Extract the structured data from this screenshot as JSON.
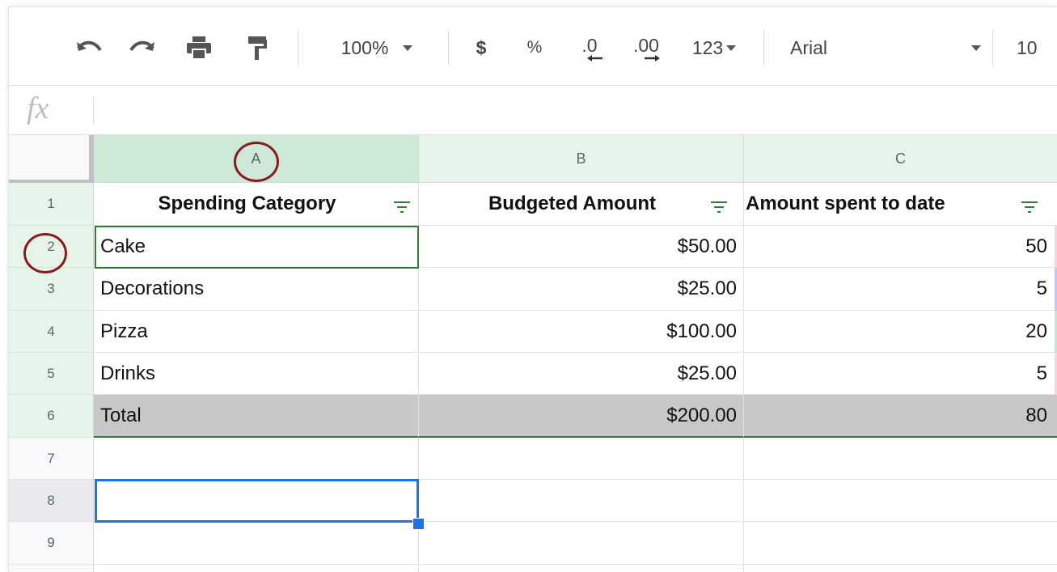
{
  "toolbar": {
    "zoom": "100%",
    "currency_label": "$",
    "percent_label": "%",
    "decrease_decimal_label": ".0",
    "increase_decimal_label": ".00",
    "more_formats_label": "123",
    "font": "Arial",
    "font_size": "10"
  },
  "formula_bar": {
    "fx_label": "fx",
    "value": ""
  },
  "columns": [
    "A",
    "B",
    "C"
  ],
  "rows": [
    "1",
    "2",
    "3",
    "4",
    "5",
    "6",
    "7",
    "8",
    "9"
  ],
  "sheet": {
    "headers": [
      "Spending Category",
      "Budgeted Amount",
      "Amount spent to date"
    ],
    "data": [
      [
        "Cake",
        "$50.00",
        "50"
      ],
      [
        "Decorations",
        "$25.00",
        "5"
      ],
      [
        "Pizza",
        "$100.00",
        "20"
      ],
      [
        "Drinks",
        "$25.00",
        "5"
      ]
    ],
    "total": [
      "Total",
      "$200.00",
      "80"
    ]
  },
  "colors": {
    "selection_border": "#2e7d32",
    "active_cell_border": "#1a73e8",
    "annotation_circle": "#8b1a1a",
    "header_highlight": "#e6f4ea",
    "total_row_fill": "#c8c8c8"
  }
}
